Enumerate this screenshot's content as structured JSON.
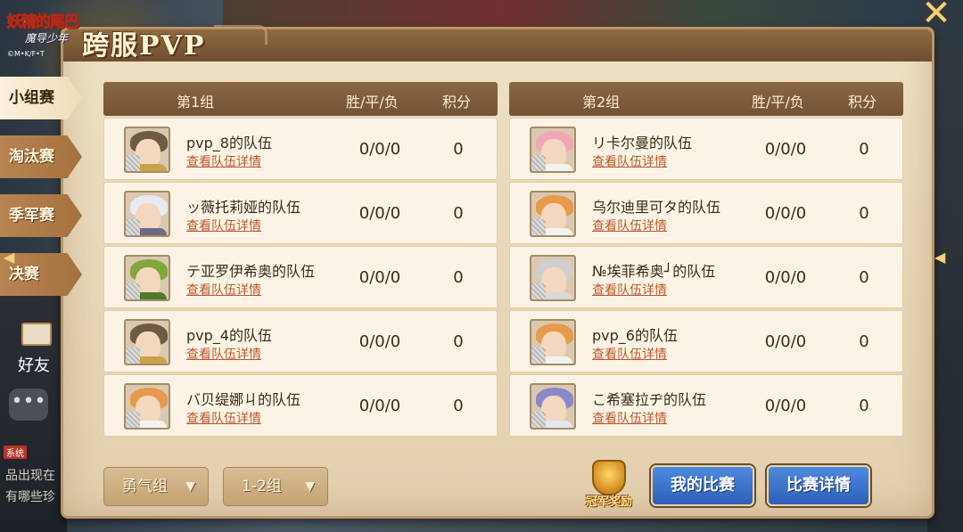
{
  "logo": {
    "main": "妖精的尾巴",
    "sub": "魔导少年",
    "copy": "©M•K/F•T"
  },
  "title": "跨服PVP",
  "close_label": "✕",
  "side_tabs": [
    {
      "label": "小组赛",
      "active": true
    },
    {
      "label": "淘汰赛",
      "active": false
    },
    {
      "label": "季军赛",
      "active": false
    },
    {
      "label": "决赛",
      "active": false
    }
  ],
  "columns": {
    "wdl": "胜/平/负",
    "score": "积分"
  },
  "groups": [
    {
      "name": "第1组",
      "rows": [
        {
          "team": "pvp_8的队伍",
          "link": "查看队伍详情",
          "wdl": "0/0/0",
          "score": "0",
          "hair": "#6e5a45",
          "body": "#c9a24a"
        },
        {
          "team": "ッ薇托莉娅的队伍",
          "link": "查看队伍详情",
          "wdl": "0/0/0",
          "score": "0",
          "hair": "#e9e9f2",
          "body": "#6a6a88"
        },
        {
          "team": "テ亚罗伊希奥的队伍",
          "link": "查看队伍详情",
          "wdl": "0/0/0",
          "score": "0",
          "hair": "#7fa83a",
          "body": "#4e7a2a"
        },
        {
          "team": "pvp_4的队伍",
          "link": "查看队伍详情",
          "wdl": "0/0/0",
          "score": "0",
          "hair": "#6e5a45",
          "body": "#c9a24a"
        },
        {
          "team": "バ贝缇娜ㄐ的队伍",
          "link": "查看队伍详情",
          "wdl": "0/0/0",
          "score": "0",
          "hair": "#e79a4a",
          "body": "#f2f2f2"
        }
      ]
    },
    {
      "name": "第2组",
      "rows": [
        {
          "team": "リ卡尔曼的队伍",
          "link": "查看队伍详情",
          "wdl": "0/0/0",
          "score": "0",
          "hair": "#f0a8b8",
          "body": "#f2f2f2"
        },
        {
          "team": "乌尔迪里可タ的队伍",
          "link": "查看队伍详情",
          "wdl": "0/0/0",
          "score": "0",
          "hair": "#e79a4a",
          "body": "#f2f2f2"
        },
        {
          "team": "№埃菲希奥┘的队伍",
          "link": "查看队伍详情",
          "wdl": "0/0/0",
          "score": "0",
          "hair": "#cfcfcf",
          "body": "#d8d8d8"
        },
        {
          "team": "pvp_6的队伍",
          "link": "查看队伍详情",
          "wdl": "0/0/0",
          "score": "0",
          "hair": "#e79a4a",
          "body": "#f2f2f2"
        },
        {
          "team": "こ希塞拉ヂ的队伍",
          "link": "查看队伍详情",
          "wdl": "0/0/0",
          "score": "0",
          "hair": "#8a88c8",
          "body": "#e6e6f2"
        }
      ]
    }
  ],
  "bottom": {
    "dropdown_group": "勇气组",
    "dropdown_range": "1-2组",
    "trophy_label": "冠军奖励",
    "my_match": "我的比赛",
    "match_details": "比赛详情"
  },
  "background": {
    "friend_label": "好友",
    "tag": "系统",
    "lines": [
      "品出现在",
      "有哪些珍"
    ]
  }
}
